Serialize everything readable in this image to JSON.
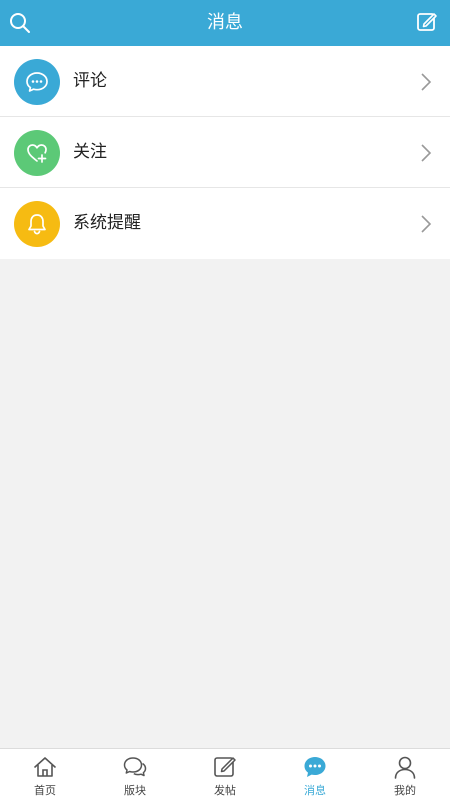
{
  "header": {
    "title": "消息",
    "search_icon": "search-icon",
    "compose_icon": "compose-icon",
    "background": "#3aa9d6"
  },
  "list": {
    "items": [
      {
        "label": "评论",
        "icon": "comment-icon",
        "color": "#3aa9d6"
      },
      {
        "label": "关注",
        "icon": "heart-plus-icon",
        "color": "#5cc977"
      },
      {
        "label": "系统提醒",
        "icon": "bell-icon",
        "color": "#f6bb12"
      }
    ]
  },
  "tabbar": {
    "active": "消息",
    "tabs": [
      {
        "label": "首页",
        "icon": "home-icon"
      },
      {
        "label": "版块",
        "icon": "forum-icon"
      },
      {
        "label": "发帖",
        "icon": "post-icon"
      },
      {
        "label": "消息",
        "icon": "message-icon"
      },
      {
        "label": "我的",
        "icon": "profile-icon"
      }
    ]
  }
}
